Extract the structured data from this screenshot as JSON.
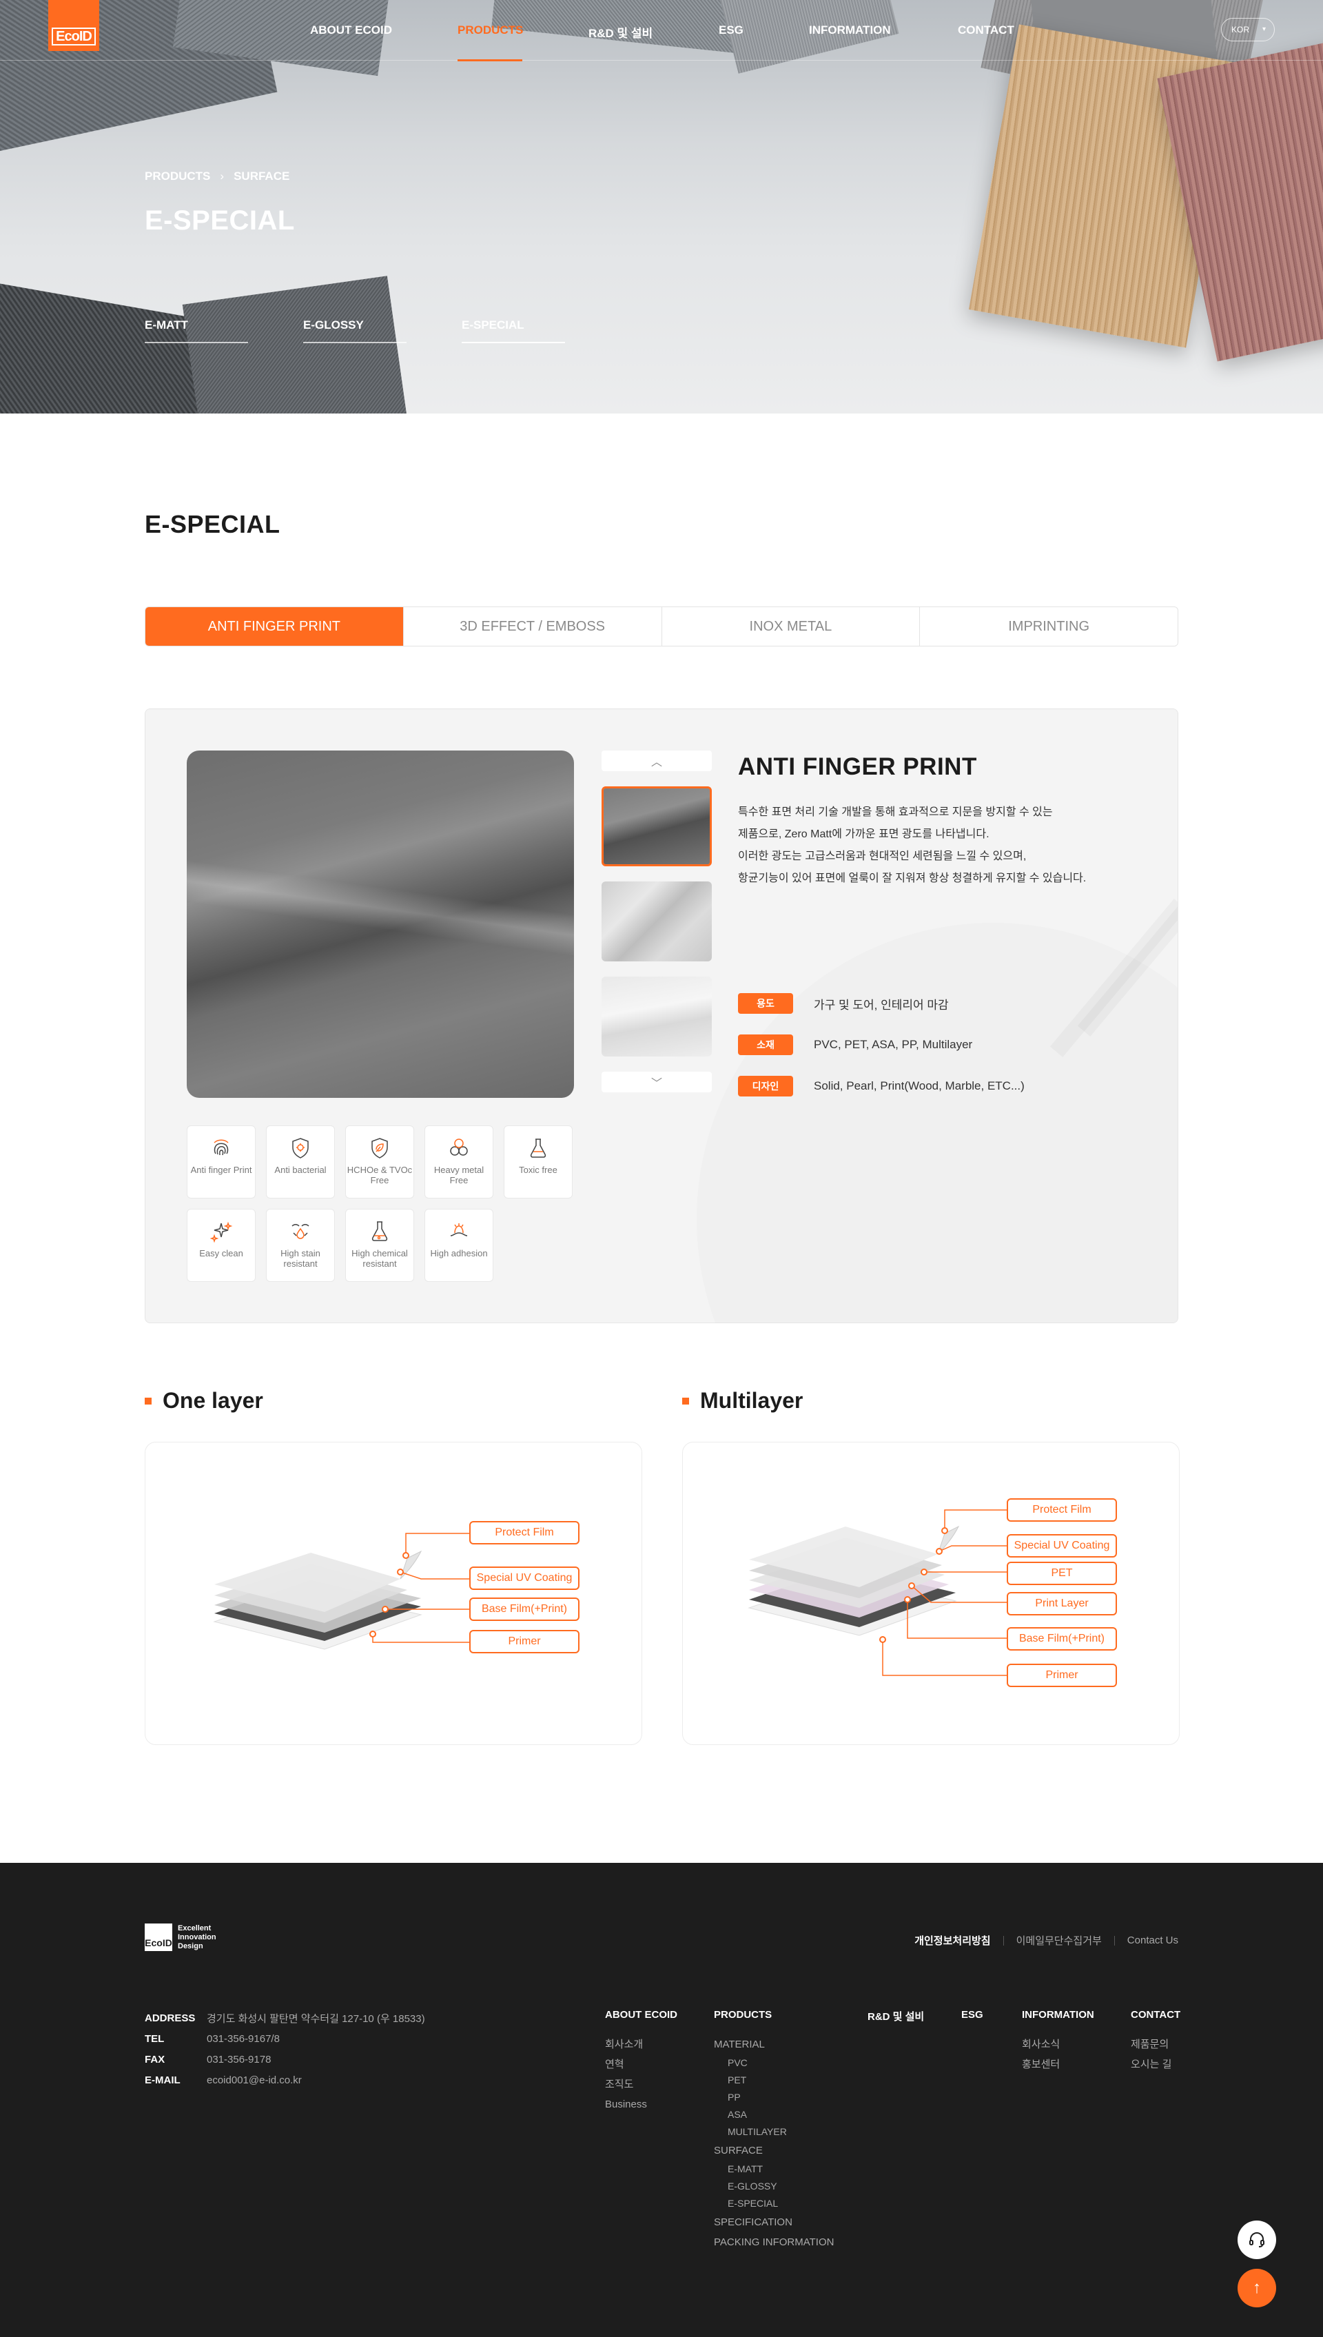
{
  "brand": {
    "logo_text": "EcoID",
    "accent": "#ff6b1f"
  },
  "nav": {
    "items": [
      "ABOUT ECOID",
      "PRODUCTS",
      "R&D 및 설비",
      "ESG",
      "INFORMATION",
      "CONTACT"
    ],
    "active": "PRODUCTS",
    "lang": "KOR"
  },
  "hero": {
    "breadcrumb": [
      "PRODUCTS",
      "SURFACE"
    ],
    "title": "E-SPECIAL",
    "subtabs": [
      "E-MATT",
      "E-GLOSSY",
      "E-SPECIAL"
    ],
    "active_subtab": "E-SPECIAL"
  },
  "section": {
    "title": "E-SPECIAL"
  },
  "tabs": {
    "items": [
      "ANTI FINGER PRINT",
      "3D EFFECT / EMBOSS",
      "INOX METAL",
      "IMPRINTING"
    ],
    "active": "ANTI FINGER PRINT"
  },
  "product": {
    "title": "ANTI FINGER PRINT",
    "description": [
      "특수한 표면 처리 기술 개발을 통해 효과적으로 지문을 방지할 수 있는",
      "제품으로, Zero Matt에 가까운 표면 광도를 나타냅니다.",
      "이러한 광도는 고급스러움과 현대적인 세련됨을 느낄 수 있으며,",
      "항균기능이 있어 표면에 얼룩이 잘 지워져 항상 청결하게 유지할 수 있습니다."
    ],
    "specs": [
      {
        "label": "용도",
        "value": "가구 및 도어, 인테리어 마감"
      },
      {
        "label": "소재",
        "value": "PVC, PET, ASA, PP, Multilayer"
      },
      {
        "label": "디자인",
        "value": "Solid, Pearl, Print(Wood, Marble, ETC...)"
      }
    ],
    "features": [
      {
        "icon": "fingerprint-icon",
        "label": "Anti finger Print"
      },
      {
        "icon": "shield-icon",
        "label": "Anti bacterial"
      },
      {
        "icon": "leaf-shield-icon",
        "label": "HCHOe & TVOc Free"
      },
      {
        "icon": "molecule-icon",
        "label": "Heavy metal Free"
      },
      {
        "icon": "flask-icon",
        "label": "Toxic free"
      },
      {
        "icon": "sparkle-icon",
        "label": "Easy clean"
      },
      {
        "icon": "stain-icon",
        "label": "High stain resistant"
      },
      {
        "icon": "chemical-icon",
        "label": "High chemical resistant"
      },
      {
        "icon": "adhesion-icon",
        "label": "High adhesion"
      }
    ]
  },
  "layers": {
    "one": {
      "title": "One layer",
      "labels": [
        "Protect Film",
        "Special UV Coating",
        "Base Film(+Print)",
        "Primer"
      ]
    },
    "multi": {
      "title": "Multilayer",
      "labels": [
        "Protect Film",
        "Special UV Coating",
        "PET",
        "Print Layer",
        "Base Film(+Print)",
        "Primer"
      ]
    }
  },
  "footer": {
    "logo_text": "EcoID",
    "tagline": [
      "Excellent",
      "Innovation",
      "Design"
    ],
    "links": [
      "개인정보처리방침",
      "이메일무단수집거부",
      "Contact Us"
    ],
    "info": [
      {
        "k": "ADDRESS",
        "v": "경기도 화성시 팔탄면 약수터길 127-10 (우 18533)"
      },
      {
        "k": "TEL",
        "v": "031-356-9167/8"
      },
      {
        "k": "FAX",
        "v": "031-356-9178"
      },
      {
        "k": "E-MAIL",
        "v": "ecoid001@e-id.co.kr"
      }
    ],
    "columns": [
      {
        "title": "ABOUT ECOID",
        "items": [
          "회사소개",
          "연혁",
          "조직도",
          "Business"
        ]
      },
      {
        "title": "PRODUCTS",
        "items": [
          "MATERIAL",
          "PVC",
          "PET",
          "PP",
          "ASA",
          "MULTILAYER",
          "SURFACE",
          "E-MATT",
          "E-GLOSSY",
          "E-SPECIAL",
          "SPECIFICATION",
          "PACKING INFORMATION"
        ]
      },
      {
        "title": "R&D 및 설비",
        "items": []
      },
      {
        "title": "ESG",
        "items": []
      },
      {
        "title": "INFORMATION",
        "items": [
          "회사소식",
          "홍보센터"
        ]
      },
      {
        "title": "CONTACT",
        "items": [
          "제품문의",
          "오시는 길"
        ]
      }
    ]
  }
}
